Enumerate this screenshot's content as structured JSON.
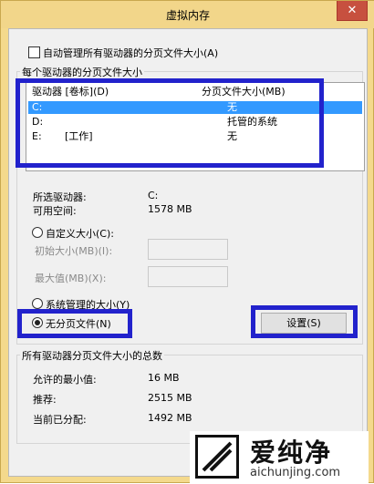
{
  "window": {
    "title": "虚拟内存",
    "close_glyph": "✕"
  },
  "auto_manage": {
    "label": "自动管理所有驱动器的分页文件大小(A)",
    "checked": false
  },
  "per_drive_group": {
    "label": "每个驱动器的分页文件大小",
    "columns": [
      "驱动器 [卷标](D)",
      "分页文件大小(MB)"
    ],
    "rows": [
      {
        "drive": "C:",
        "label": "",
        "size": "无",
        "selected": true
      },
      {
        "drive": "D:",
        "label": "",
        "size": "托管的系统",
        "selected": false
      },
      {
        "drive": "E:",
        "label": "[工作]",
        "size": "无",
        "selected": false
      }
    ],
    "selected_drive_label": "所选驱动器:",
    "selected_drive_value": "C:",
    "free_space_label": "可用空间:",
    "free_space_value": "1578 MB",
    "custom_size_label": "自定义大小(C):",
    "initial_size_label": "初始大小(MB)(I):",
    "max_size_label": "最大值(MB)(X):",
    "system_managed_label": "系统管理的大小(Y)",
    "no_paging_label": "无分页文件(N)",
    "set_button_label": "设置(S)",
    "selected_option": "no_paging"
  },
  "total_group": {
    "label": "所有驱动器分页文件大小的总数",
    "min_allowed_label": "允许的最小值:",
    "min_allowed_value": "16 MB",
    "recommended_label": "推荐:",
    "recommended_value": "2515 MB",
    "current_label": "当前已分配:",
    "current_value": "1492 MB"
  },
  "watermark": {
    "brand": "爱纯净",
    "url": "aichunjing.com"
  },
  "colors": {
    "titlebar": "#f2d68a",
    "close": "#c7503f",
    "selection": "#3399ff",
    "highlight": "#2222cc"
  }
}
